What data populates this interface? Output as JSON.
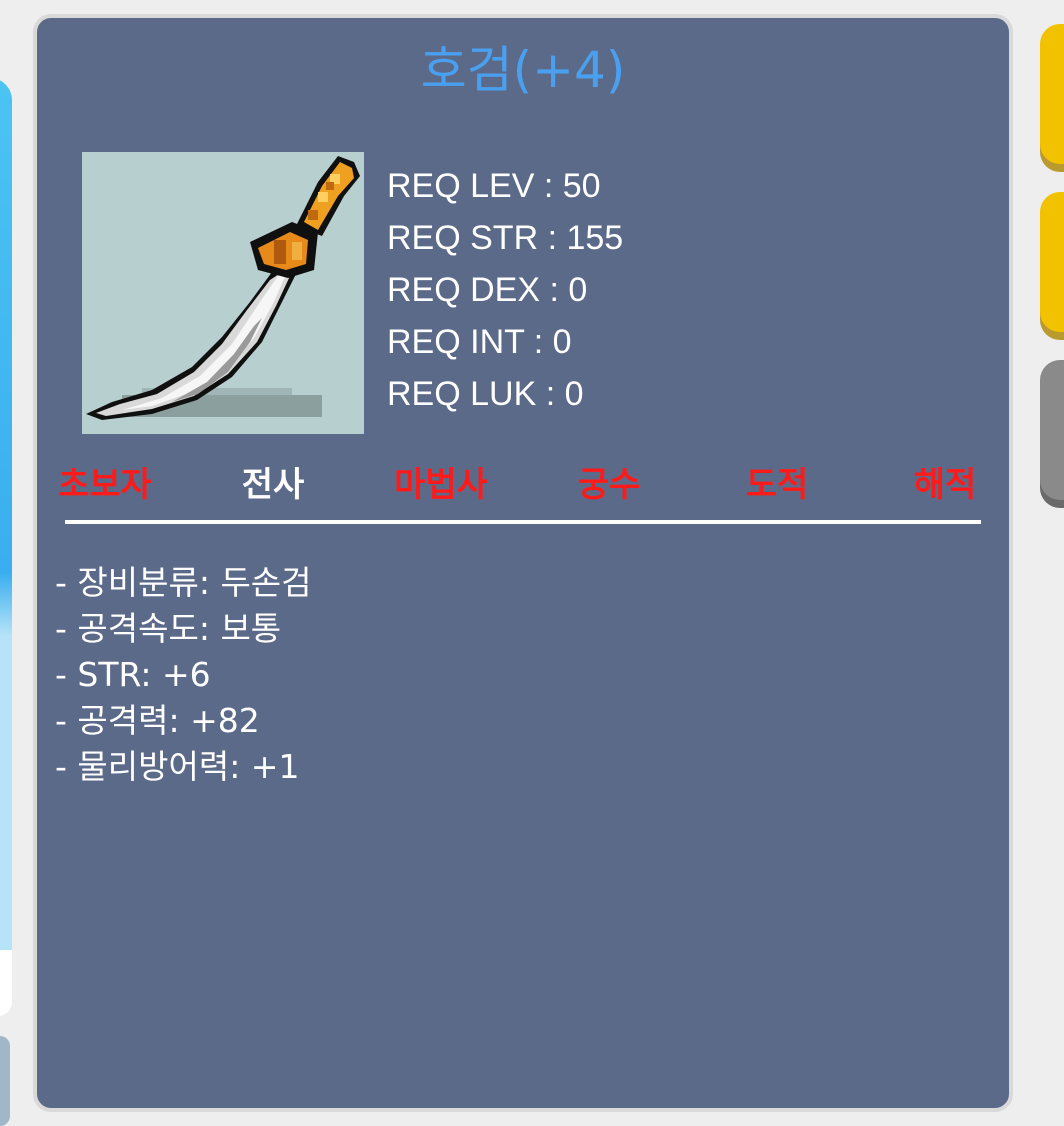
{
  "item": {
    "title": "호검(+4)",
    "image_name": "sword-image"
  },
  "requirements": [
    {
      "label": "REQ LEV : 50"
    },
    {
      "label": "REQ STR : 155"
    },
    {
      "label": "REQ DEX : 0"
    },
    {
      "label": "REQ INT : 0"
    },
    {
      "label": "REQ LUK : 0"
    }
  ],
  "classes": [
    {
      "label": "초보자",
      "allowed": false
    },
    {
      "label": "전사",
      "allowed": true
    },
    {
      "label": "마법사",
      "allowed": false
    },
    {
      "label": "궁수",
      "allowed": false
    },
    {
      "label": "도적",
      "allowed": false
    },
    {
      "label": "해적",
      "allowed": false
    }
  ],
  "stats": [
    "- 장비분류: 두손검",
    "- 공격속도: 보통",
    "- STR: +6",
    "- 공격력: +82",
    "- 물리방어력: +1"
  ],
  "colors": {
    "panel_bg": "#5c6a89",
    "title": "#4aa0f0",
    "class_disallowed": "#ff1a1a",
    "class_allowed": "#ffffff"
  }
}
